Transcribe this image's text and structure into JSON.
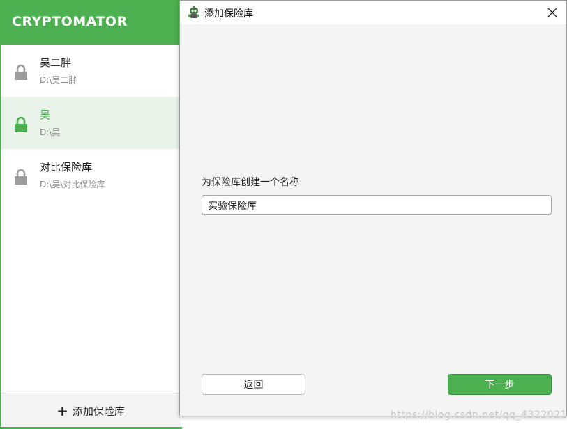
{
  "app": {
    "title": "CRYPTOMATOR",
    "accent_color": "#4caf50"
  },
  "vaults": [
    {
      "name": "吴二胖",
      "path": "D:\\吴二胖",
      "icon": "lock-icon",
      "selected": false
    },
    {
      "name": "吴",
      "path": "D:\\吴",
      "icon": "lock-icon",
      "selected": true
    },
    {
      "name": "对比保险库",
      "path": "D:\\吴\\对比保险库",
      "icon": "lock-icon",
      "selected": false
    }
  ],
  "footer": {
    "add_vault_label": "添加保险库",
    "add_icon": "plus-icon"
  },
  "dialog": {
    "title": "添加保险库",
    "prompt": "为保险库创建一个名称",
    "vault_name_value": "实验保险库",
    "back_label": "返回",
    "next_label": "下一步",
    "close_icon": "close-icon"
  },
  "watermark": "https://blog.csdn.net/qq_43220213"
}
